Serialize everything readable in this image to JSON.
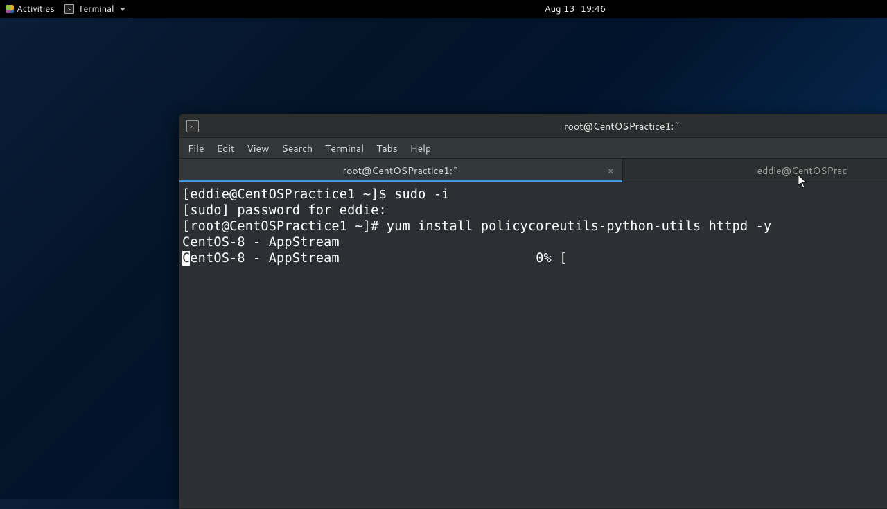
{
  "panel": {
    "activities_label": "Activities",
    "app_label": "Terminal",
    "date_label": "Aug 13",
    "time_label": "19:46"
  },
  "window": {
    "title": "root@CentOSPractice1:~"
  },
  "menubar": {
    "file": "File",
    "edit": "Edit",
    "view": "View",
    "search": "Search",
    "terminal": "Terminal",
    "tabs": "Tabs",
    "help": "Help"
  },
  "tabs": {
    "active_label": "root@CentOSPractice1:~",
    "close_glyph": "×",
    "inactive_label": "eddie@CentOSPrac"
  },
  "terminal": {
    "line1": "[eddie@CentOSPractice1 ~]$ sudo -i",
    "line2": "[sudo] password for eddie:",
    "line3": "[root@CentOSPractice1 ~]# yum install policycoreutils-python-utils httpd -y",
    "line4": "CentOS-8 - AppStream",
    "line5_cursor": "C",
    "line5_rest": "entOS-8 - AppStream                         0% [                                          ]"
  }
}
